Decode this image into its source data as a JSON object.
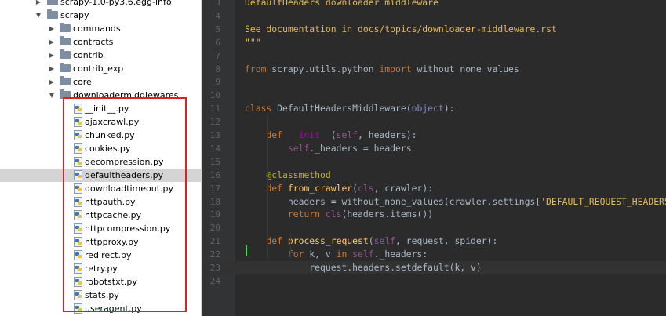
{
  "tree": {
    "rows": [
      {
        "label": "scrapy-1.0-py3.6.egg-info",
        "type": "folder",
        "expanded": false,
        "depth": 1,
        "partial": true
      },
      {
        "label": "scrapy",
        "type": "folder",
        "expanded": true,
        "depth": 1
      },
      {
        "label": "commands",
        "type": "folder",
        "expanded": false,
        "depth": 2
      },
      {
        "label": "contracts",
        "type": "folder",
        "expanded": false,
        "depth": 2
      },
      {
        "label": "contrib",
        "type": "folder",
        "expanded": false,
        "depth": 2
      },
      {
        "label": "contrib_exp",
        "type": "folder",
        "expanded": false,
        "depth": 2
      },
      {
        "label": "core",
        "type": "folder",
        "expanded": false,
        "depth": 2
      },
      {
        "label": "downloadermiddlewares",
        "type": "folder",
        "expanded": true,
        "depth": 2
      },
      {
        "label": "__init__.py",
        "type": "file",
        "depth": 3
      },
      {
        "label": "ajaxcrawl.py",
        "type": "file",
        "depth": 3
      },
      {
        "label": "chunked.py",
        "type": "file",
        "depth": 3
      },
      {
        "label": "cookies.py",
        "type": "file",
        "depth": 3
      },
      {
        "label": "decompression.py",
        "type": "file",
        "depth": 3
      },
      {
        "label": "defaultheaders.py",
        "type": "file",
        "depth": 3,
        "selected": true
      },
      {
        "label": "downloadtimeout.py",
        "type": "file",
        "depth": 3
      },
      {
        "label": "httpauth.py",
        "type": "file",
        "depth": 3
      },
      {
        "label": "httpcache.py",
        "type": "file",
        "depth": 3
      },
      {
        "label": "httpcompression.py",
        "type": "file",
        "depth": 3
      },
      {
        "label": "httpproxy.py",
        "type": "file",
        "depth": 3
      },
      {
        "label": "redirect.py",
        "type": "file",
        "depth": 3
      },
      {
        "label": "retry.py",
        "type": "file",
        "depth": 3
      },
      {
        "label": "robotstxt.py",
        "type": "file",
        "depth": 3
      },
      {
        "label": "stats.py",
        "type": "file",
        "depth": 3
      },
      {
        "label": "useragent.py",
        "type": "file",
        "depth": 3
      }
    ]
  },
  "editor": {
    "current_line": 23,
    "lines": [
      {
        "n": "3",
        "tokens": [
          [
            "docstr",
            "DefaultHeaders downloader middleware"
          ]
        ]
      },
      {
        "n": "4",
        "tokens": [
          [
            "plain",
            ""
          ]
        ]
      },
      {
        "n": "5",
        "tokens": [
          [
            "docstr",
            "See documentation in docs/topics/downloader-middleware.rst"
          ]
        ]
      },
      {
        "n": "6",
        "tokens": [
          [
            "docstr",
            "\"\"\""
          ]
        ]
      },
      {
        "n": "7",
        "tokens": [
          [
            "plain",
            ""
          ]
        ]
      },
      {
        "n": "8",
        "tokens": [
          [
            "kw",
            "from "
          ],
          [
            "plain",
            "scrapy.utils.python "
          ],
          [
            "kw",
            "import "
          ],
          [
            "plain",
            "without_none_values"
          ]
        ]
      },
      {
        "n": "9",
        "tokens": [
          [
            "plain",
            ""
          ]
        ]
      },
      {
        "n": "10",
        "tokens": [
          [
            "plain",
            ""
          ]
        ]
      },
      {
        "n": "11",
        "tokens": [
          [
            "kw",
            "class "
          ],
          [
            "plain",
            "DefaultHeadersMiddleware("
          ],
          [
            "builtin",
            "object"
          ],
          [
            "plain",
            "):"
          ]
        ]
      },
      {
        "n": "12",
        "tokens": [
          [
            "plain",
            ""
          ]
        ]
      },
      {
        "n": "13",
        "tokens": [
          [
            "plain",
            "    "
          ],
          [
            "kw",
            "def "
          ],
          [
            "magic",
            "__init__"
          ],
          [
            "plain",
            "("
          ],
          [
            "self",
            "self"
          ],
          [
            "plain",
            ", headers):"
          ]
        ]
      },
      {
        "n": "14",
        "tokens": [
          [
            "plain",
            "        "
          ],
          [
            "self",
            "self"
          ],
          [
            "plain",
            "._headers = headers"
          ]
        ]
      },
      {
        "n": "15",
        "tokens": [
          [
            "plain",
            ""
          ]
        ]
      },
      {
        "n": "16",
        "tokens": [
          [
            "plain",
            "    "
          ],
          [
            "dec",
            "@classmethod"
          ]
        ]
      },
      {
        "n": "17",
        "tokens": [
          [
            "plain",
            "    "
          ],
          [
            "kw",
            "def "
          ],
          [
            "fn",
            "from_crawler"
          ],
          [
            "plain",
            "("
          ],
          [
            "self",
            "cls"
          ],
          [
            "plain",
            ", crawler):"
          ]
        ]
      },
      {
        "n": "18",
        "tokens": [
          [
            "plain",
            "        headers = without_none_values(crawler.settings["
          ],
          [
            "str",
            "'DEFAULT_REQUEST_HEADERS'"
          ],
          [
            "plain",
            "])"
          ]
        ]
      },
      {
        "n": "19",
        "tokens": [
          [
            "plain",
            "        "
          ],
          [
            "kw",
            "return "
          ],
          [
            "self",
            "cls"
          ],
          [
            "plain",
            "(headers.items())"
          ]
        ]
      },
      {
        "n": "20",
        "tokens": [
          [
            "plain",
            ""
          ]
        ]
      },
      {
        "n": "21",
        "tokens": [
          [
            "plain",
            "    "
          ],
          [
            "kw",
            "def "
          ],
          [
            "fn",
            "process_request"
          ],
          [
            "plain",
            "("
          ],
          [
            "self",
            "self"
          ],
          [
            "plain",
            ", request, "
          ],
          [
            "param-u",
            "spider"
          ],
          [
            "plain",
            "):"
          ]
        ]
      },
      {
        "n": "22",
        "tokens": [
          [
            "plain",
            "        "
          ],
          [
            "kw",
            "for "
          ],
          [
            "plain",
            "k, v "
          ],
          [
            "kw",
            "in "
          ],
          [
            "self",
            "self"
          ],
          [
            "plain",
            "._headers:"
          ]
        ]
      },
      {
        "n": "23",
        "tokens": [
          [
            "plain",
            "            request.headers.setdefault(k, v)"
          ]
        ]
      },
      {
        "n": "24",
        "tokens": [
          [
            "plain",
            ""
          ]
        ]
      }
    ]
  }
}
